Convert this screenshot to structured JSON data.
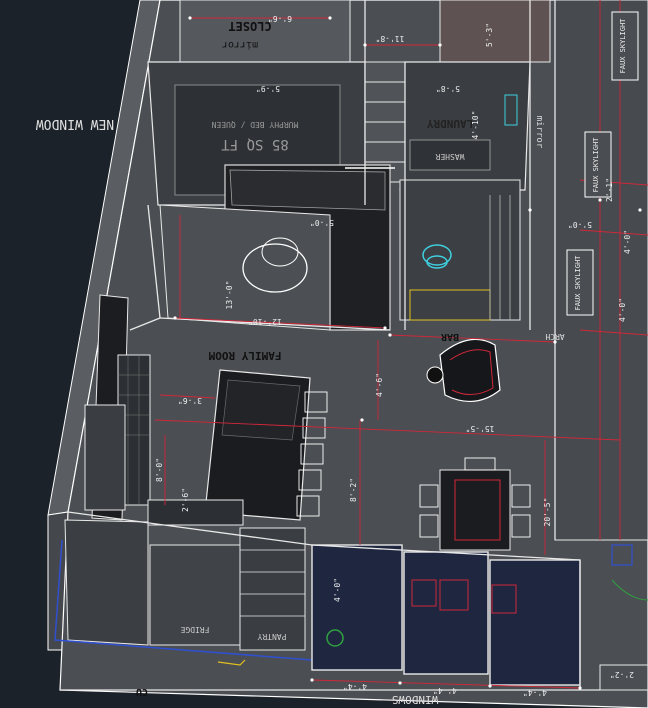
{
  "colors": {
    "background": "#1c2229",
    "floor": "#4b4e52",
    "wall_line": "#e8e8e8",
    "dimension_line": "#d0283a",
    "accent_cyan": "#3fd0e0",
    "accent_yellow": "#e0c020",
    "accent_blue": "#3050d0",
    "glass": "#1e2640"
  },
  "labels": {
    "new_window": "NEW WINDOW",
    "closet": "CLOSET",
    "mirror": "mirror",
    "mirror_right": "mirror",
    "murphy_bed": "MURPHY BED / QUEEN",
    "area": "85 SQ FT",
    "laundry": "LAUNDRY",
    "washer": "WASHER",
    "family_room": "FAMILY ROOM",
    "bar": "BAR",
    "arch": "ARCH",
    "fridge": "FRIDGE",
    "pantry": "PANTRY",
    "cu": "CU",
    "windows": "WINDOWS",
    "faux_skylight_1": "FAUX SKYLIGHT",
    "faux_skylight_2": "FAUX SKYLIGHT",
    "faux_skylight_3": "FAUX SKYLIGHT"
  },
  "dimensions": {
    "d1": "6'-6\"",
    "d2": "11'-8\"",
    "d3": "5'-3\"",
    "d4": "4'-10\"",
    "d5": "5'-9\"",
    "d6": "5'-8\"",
    "d7": "2'-1\"",
    "d8": "5'-0\"",
    "d9": "4'-0\"",
    "d10": "13'-0\"",
    "d11": "12'-10\"",
    "d12": "5'-0\"",
    "d13": "4'-6\"",
    "d14": "15'-5\"",
    "d15": "3'-6\"",
    "d16": "8'-0\"",
    "d17": "2'-6\"",
    "d18": "8'-2\"",
    "d19": "20'-5\"",
    "d20": "4'-0\"",
    "d21": "4'-4\"",
    "d22": "4'-4\"",
    "d23": "4'-4\"",
    "d24": "2'-2\"",
    "d25": "4'-0\""
  }
}
